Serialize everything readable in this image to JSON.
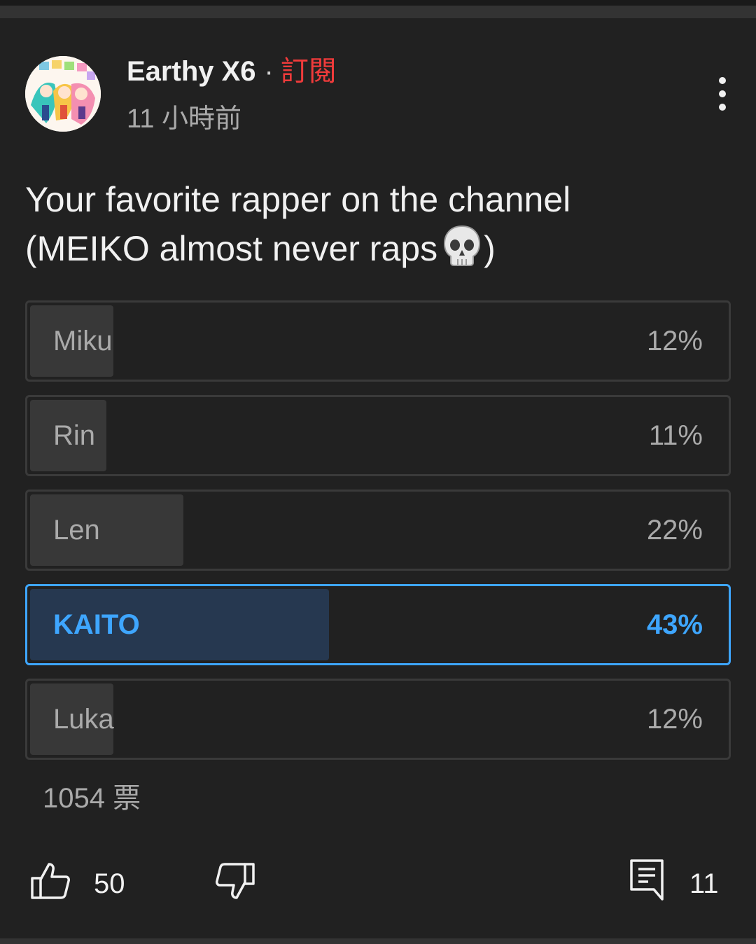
{
  "post": {
    "author": "Earthy X6",
    "separator": "·",
    "subscribe_label": "訂閱",
    "time": "11 小時前",
    "text_line1": "Your favorite rapper on the channel",
    "text_line2_before": "(MEIKO almost never raps",
    "text_line2_emoji": "skull-emoji",
    "text_line2_after": ")"
  },
  "poll": {
    "options": [
      {
        "label": "Miku",
        "percent_text": "12%",
        "percent": 12,
        "selected": false
      },
      {
        "label": "Rin",
        "percent_text": "11%",
        "percent": 11,
        "selected": false
      },
      {
        "label": "Len",
        "percent_text": "22%",
        "percent": 22,
        "selected": false
      },
      {
        "label": "KAITO",
        "percent_text": "43%",
        "percent": 43,
        "selected": true
      },
      {
        "label": "Luka",
        "percent_text": "12%",
        "percent": 12,
        "selected": false
      }
    ],
    "votes": "1054 票"
  },
  "actions": {
    "like_count": "50",
    "comment_count": "11",
    "icons": [
      "thumbs-up-icon",
      "thumbs-down-icon",
      "comment-icon",
      "more-vert-icon"
    ]
  },
  "colors": {
    "background": "#212121",
    "accent": "#3ea6ff",
    "subscribe": "#f03b3b",
    "secondary_text": "#aaaaaa"
  }
}
